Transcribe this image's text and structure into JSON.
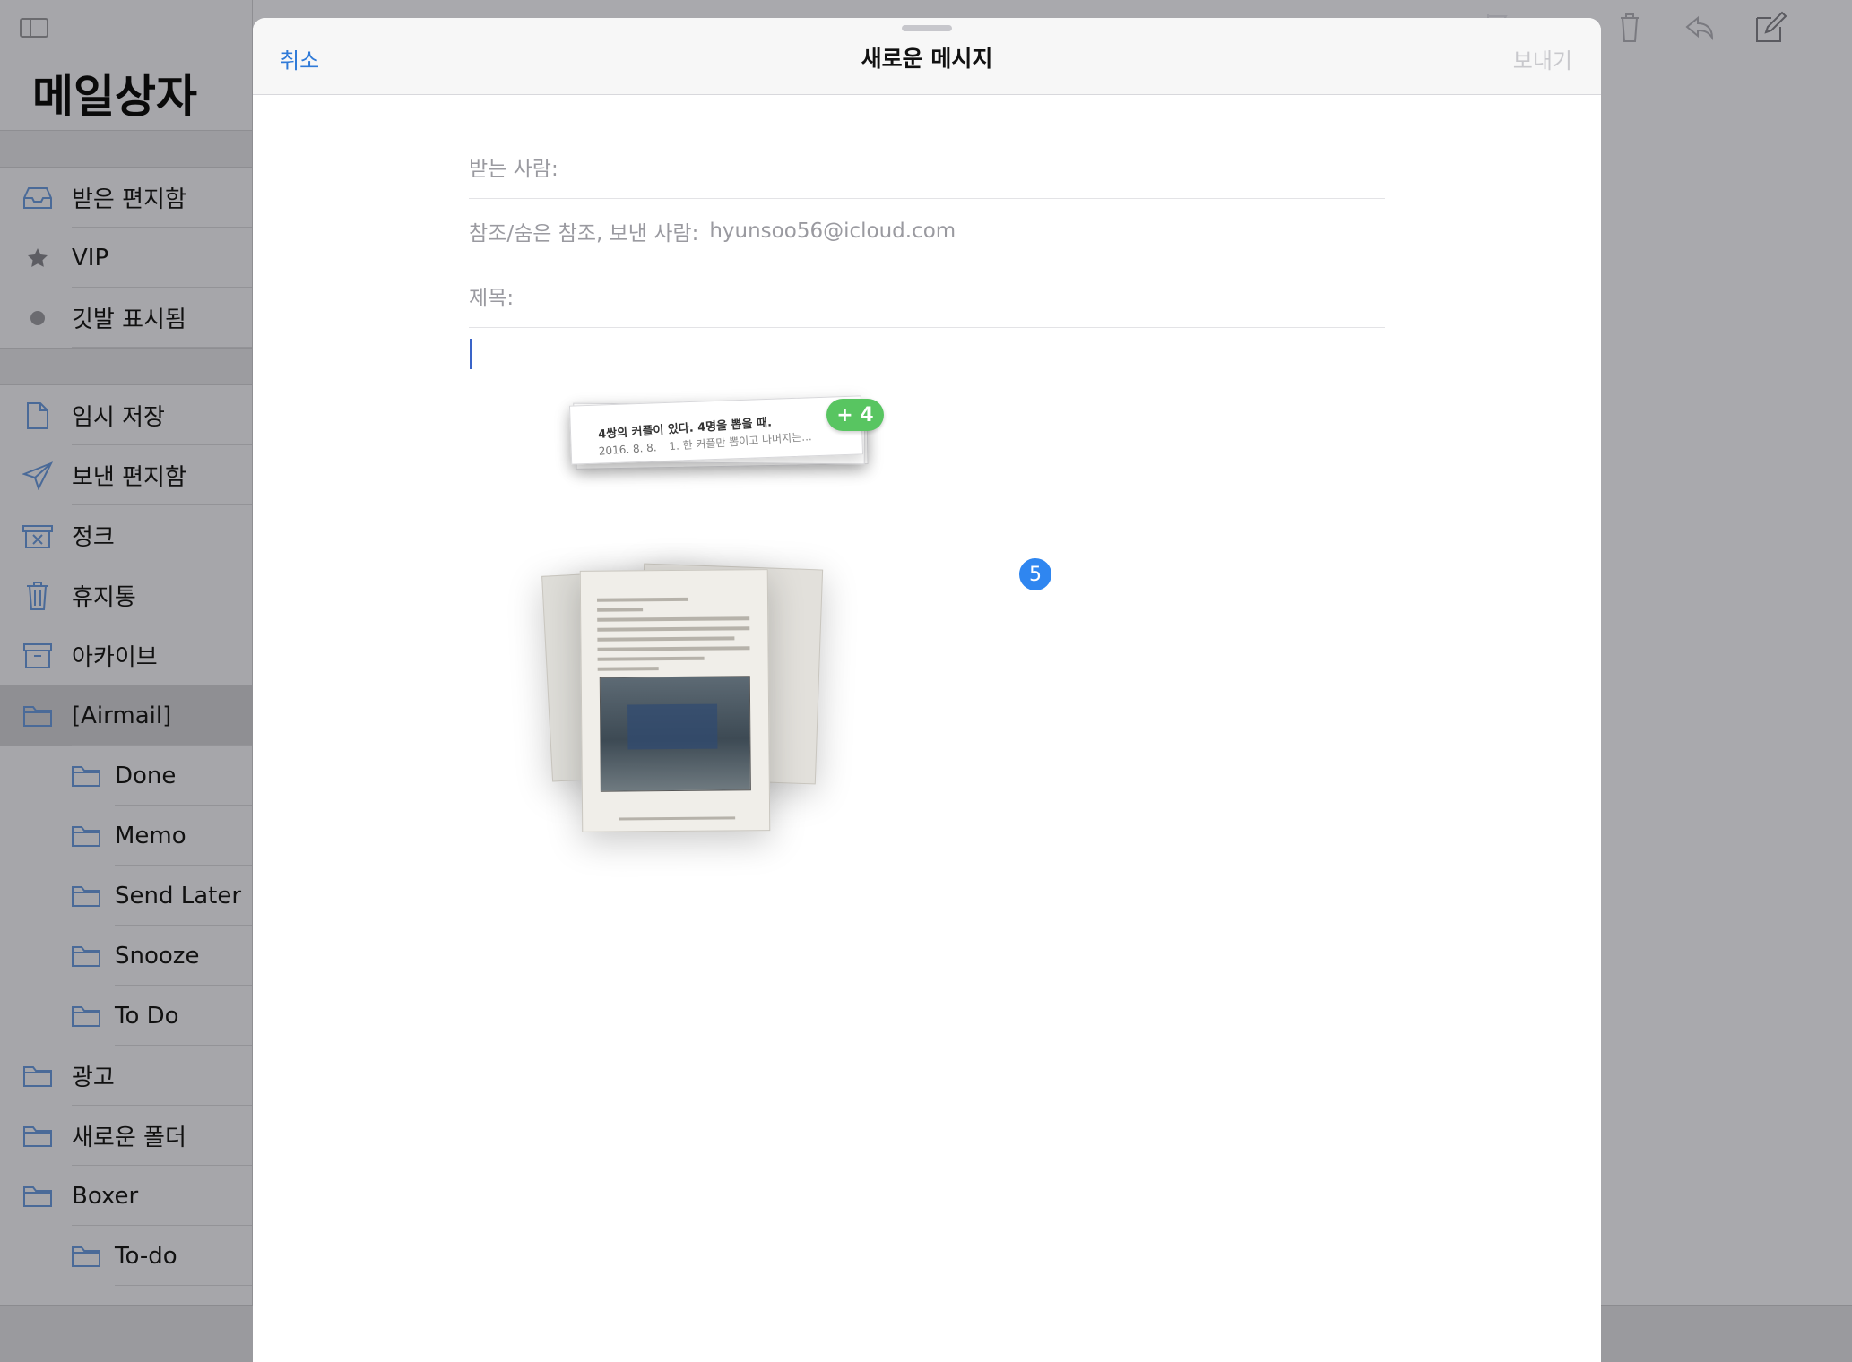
{
  "sidebar": {
    "title": "메일상자",
    "items": [
      {
        "label": "받은 편지함",
        "icon": "inbox-icon",
        "sub": false
      },
      {
        "label": "VIP",
        "icon": "star-icon",
        "sub": false
      },
      {
        "label": "깃발 표시됨",
        "icon": "flag-dot-icon",
        "sub": false
      },
      {
        "label": "임시 저장",
        "icon": "draft-document-icon",
        "sub": false
      },
      {
        "label": "보낸 편지함",
        "icon": "paper-plane-icon",
        "sub": false
      },
      {
        "label": "정크",
        "icon": "junk-bin-icon",
        "sub": false
      },
      {
        "label": "휴지통",
        "icon": "trash-icon",
        "sub": false
      },
      {
        "label": "아카이브",
        "icon": "archive-box-icon",
        "sub": false
      },
      {
        "label": "[Airmail]",
        "icon": "folder-icon",
        "sub": false,
        "active": true
      },
      {
        "label": "Done",
        "icon": "folder-icon",
        "sub": true
      },
      {
        "label": "Memo",
        "icon": "folder-icon",
        "sub": true
      },
      {
        "label": "Send Later",
        "icon": "folder-icon",
        "sub": true
      },
      {
        "label": "Snooze",
        "icon": "folder-icon",
        "sub": true
      },
      {
        "label": "To Do",
        "icon": "folder-icon",
        "sub": true
      },
      {
        "label": "광고",
        "icon": "folder-icon",
        "sub": false
      },
      {
        "label": "새로운 폴더",
        "icon": "folder-icon",
        "sub": false
      },
      {
        "label": "Boxer",
        "icon": "folder-icon",
        "sub": false
      },
      {
        "label": "To-do",
        "icon": "folder-icon",
        "sub": true
      }
    ]
  },
  "toolbar_icons": [
    "flag-icon",
    "folder-move-icon",
    "trash-icon",
    "reply-icon",
    "compose-icon"
  ],
  "compose": {
    "cancel_label": "취소",
    "title": "새로운 메시지",
    "send_label": "보내기",
    "to_label": "받는 사람:",
    "cc_label": "참조/숨은 참조, 보낸 사람:",
    "cc_value": "hyunsoo56@icloud.com",
    "subject_label": "제목:"
  },
  "drag": {
    "card_title": "4쌍의 커플이 있다. 4명을 뽑을 때.",
    "card_date": "2016. 8. 8.",
    "card_preview": "1. 한 커플만 뽑이고 나머지는...",
    "plus_badge": "+ 4",
    "count_badge": "5"
  }
}
